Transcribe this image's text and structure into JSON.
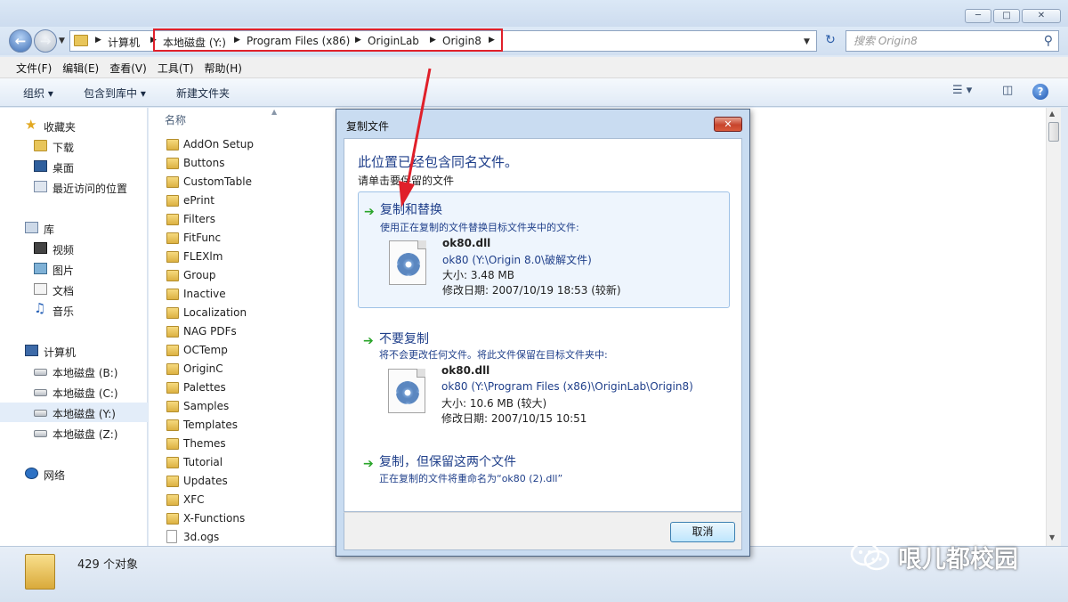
{
  "window": {
    "controls": {
      "minimize": "─",
      "maximize": "□",
      "close": "✕"
    }
  },
  "address": {
    "crumbs": [
      "计算机",
      "本地磁盘 (Y:)",
      "Program Files (x86)",
      "OriginLab",
      "Origin8"
    ],
    "search_placeholder": "搜索 Origin8"
  },
  "menu": [
    "文件(F)",
    "编辑(E)",
    "查看(V)",
    "工具(T)",
    "帮助(H)"
  ],
  "toolbar": {
    "organize": "组织 ▾",
    "include_library": "包含到库中 ▾",
    "new_folder": "新建文件夹",
    "help": "?"
  },
  "nav": {
    "favorites": "收藏夹",
    "downloads": "下载",
    "desktop": "桌面",
    "recent": "最近访问的位置",
    "libraries": "库",
    "videos": "视频",
    "pictures": "图片",
    "documents": "文档",
    "music": "音乐",
    "computer": "计算机",
    "drive_b": "本地磁盘 (B:)",
    "drive_c": "本地磁盘 (C:)",
    "drive_y": "本地磁盘 (Y:)",
    "drive_z": "本地磁盘 (Z:)",
    "network": "网络"
  },
  "files": {
    "column_name": "名称",
    "items": [
      {
        "name": "AddOn Setup",
        "type": "folder"
      },
      {
        "name": "Buttons",
        "type": "folder"
      },
      {
        "name": "CustomTable",
        "type": "folder"
      },
      {
        "name": "ePrint",
        "type": "folder"
      },
      {
        "name": "Filters",
        "type": "folder"
      },
      {
        "name": "FitFunc",
        "type": "folder"
      },
      {
        "name": "FLEXlm",
        "type": "folder"
      },
      {
        "name": "Group",
        "type": "folder"
      },
      {
        "name": "Inactive",
        "type": "folder"
      },
      {
        "name": "Localization",
        "type": "folder"
      },
      {
        "name": "NAG PDFs",
        "type": "folder"
      },
      {
        "name": "OCTemp",
        "type": "folder"
      },
      {
        "name": "OriginC",
        "type": "folder"
      },
      {
        "name": "Palettes",
        "type": "folder"
      },
      {
        "name": "Samples",
        "type": "folder"
      },
      {
        "name": "Templates",
        "type": "folder"
      },
      {
        "name": "Themes",
        "type": "folder"
      },
      {
        "name": "Tutorial",
        "type": "folder"
      },
      {
        "name": "Updates",
        "type": "folder"
      },
      {
        "name": "XFC",
        "type": "folder"
      },
      {
        "name": "X-Functions",
        "type": "folder"
      },
      {
        "name": "3d.ogs",
        "type": "file"
      }
    ]
  },
  "status": {
    "count": "429 个对象"
  },
  "watermark": "哏儿都校园",
  "dialog": {
    "title": "复制文件",
    "heading": "此位置已经包含同名文件。",
    "subheading": "请单击要保留的文件",
    "option_replace": {
      "title": "复制和替换",
      "desc": "使用正在复制的文件替换目标文件夹中的文件:",
      "file_name": "ok80.dll",
      "file_path": "ok80 (Y:\\Origin 8.0\\破解文件)",
      "size": "大小: 3.48 MB",
      "date": "修改日期: 2007/10/19 18:53 (较新)"
    },
    "option_skip": {
      "title": "不要复制",
      "desc": "将不会更改任何文件。将此文件保留在目标文件夹中:",
      "file_name": "ok80.dll",
      "file_path": "ok80 (Y:\\Program Files (x86)\\OriginLab\\Origin8)",
      "size": "大小: 10.6 MB (较大)",
      "date": "修改日期: 2007/10/15 10:51"
    },
    "option_keep_both": {
      "title": "复制，但保留这两个文件",
      "desc": "正在复制的文件将重命名为“ok80 (2).dll”"
    },
    "cancel": "取消"
  },
  "colors": {
    "highlight_box": "#e0202a",
    "annotation_arrow": "#e0202a",
    "dialog_link": "#1f3f8a",
    "option_arrow": "#2aa52a"
  }
}
